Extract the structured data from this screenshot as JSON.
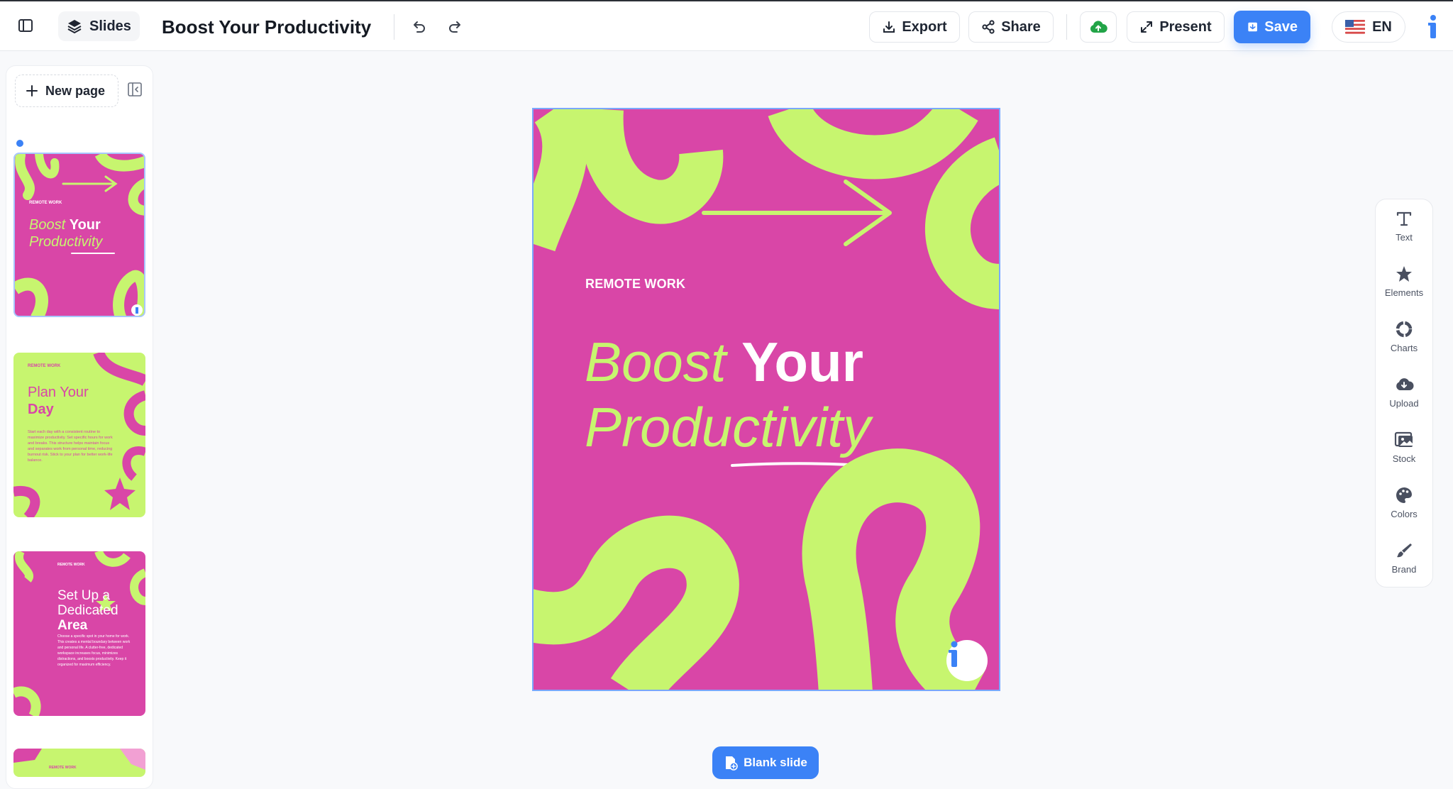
{
  "header": {
    "slides_label": "Slides",
    "title": "Boost Your Productivity",
    "export_label": "Export",
    "share_label": "Share",
    "present_label": "Present",
    "save_label": "Save",
    "language": "EN"
  },
  "sidebar": {
    "new_page_label": "New page",
    "thumbnails": [
      {
        "kicker": "REMOTE WORK",
        "title_italic": "Boost",
        "title_bold": "Your",
        "title_line2": "Productivity"
      },
      {
        "kicker": "REMOTE WORK",
        "title_line1": "Plan Your",
        "title_line2": "Day",
        "body": "Start each day with a consistent routine to maximize productivity. Set specific hours for work and breaks. This structure helps maintain focus and separates work from personal time, reducing burnout risk. Stick to your plan for better work-life balance."
      },
      {
        "kicker": "REMOTE WORK",
        "title_line1": "Set Up a",
        "title_line2": "Dedicated",
        "title_line3": "Area",
        "body": "Choose a specific spot in your home for work. This creates a mental boundary between work and personal life. A clutter-free, dedicated workspace increases focus, minimizes distractions, and boosts productivity. Keep it organized for maximum efficiency."
      },
      {
        "kicker": "REMOTE WORK"
      }
    ]
  },
  "slide": {
    "kicker": "REMOTE WORK",
    "title_italic": "Boost",
    "title_bold": "Your",
    "title_line2": "Productivity"
  },
  "tools": [
    {
      "label": "Text",
      "icon": "text-icon"
    },
    {
      "label": "Elements",
      "icon": "star-icon"
    },
    {
      "label": "Charts",
      "icon": "pie-chart-icon"
    },
    {
      "label": "Upload",
      "icon": "cloud-upload-icon"
    },
    {
      "label": "Stock",
      "icon": "image-icon"
    },
    {
      "label": "Colors",
      "icon": "palette-icon"
    },
    {
      "label": "Brand",
      "icon": "brush-icon"
    }
  ],
  "footer": {
    "blank_slide_label": "Blank slide"
  },
  "colors": {
    "accent": "#3b82f6",
    "slide_pink": "#d946a7",
    "slide_lime": "#c7f56f",
    "cloud_green": "#22a447"
  }
}
